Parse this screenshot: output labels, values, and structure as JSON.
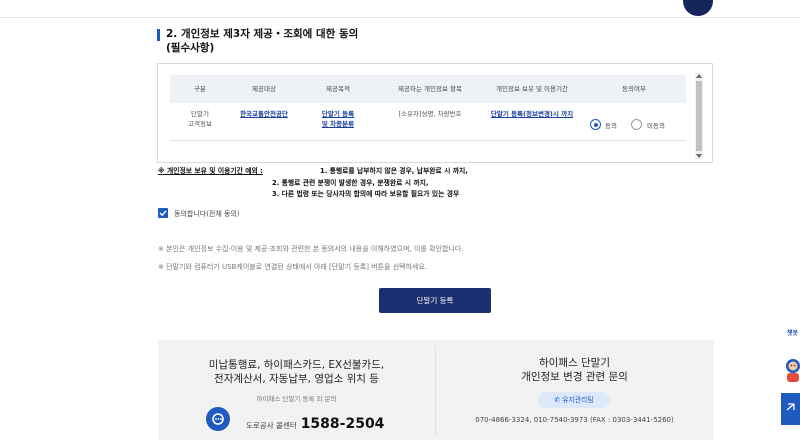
{
  "section": {
    "title": "2. 개인정보 제3자 제공・조회에 대한 동의",
    "subtitle": "(필수사항)"
  },
  "table": {
    "headers": [
      "구분",
      "제공대상",
      "제공목적",
      "제공하는 개인정보 항목",
      "개인정보 보유 및 이용기간",
      "동의여부"
    ],
    "row": {
      "type_line1": "단말기",
      "type_line2": "고객정보",
      "provider": "한국교통안전공단",
      "purpose_line1": "단말기 등록",
      "purpose_line2": "및 차종분류",
      "items": "[소유자]성명, 차량번호",
      "period": "단말기 등록(정보변경)시 까지",
      "agree_label": "동의",
      "disagree_label": "미동의",
      "agree_selected": true
    }
  },
  "retention_note": {
    "prefix": "※ 개인정보 보유 및 이용기간 예외 :",
    "line1": "1. 통행료를 납부하지 않은 경우, 납부완료 시 까지,",
    "line2": "2. 통행료 관련 분쟁이 발생한 경우, 분쟁완료 시 까지,",
    "line3": "3. 다른 법령 또는 당사자의 합의에 따라 보유할 필요가 있는 경우"
  },
  "consent_all": {
    "label": "동의합니다(전체 동의)",
    "checked": true
  },
  "notices": [
    "※ 본인은 개인정보 수집·이용 및 제공·조회와 관련한 본 동의서의 내용을 이해하였으며, 이를 확인합니다.",
    "※ 단말기와 컴퓨터가 USB케이블로 연결된 상태에서 아래 [단말기 등록] 버튼을 선택하세요."
  ],
  "register_button": "단말기 등록",
  "info_left": {
    "line1": "미납통행료, 하이패스카드, EX선불카드,",
    "line2": "전자계산서, 자동납부, 영업소 위치 등",
    "sub": "하이패스 단말기 등록 외 문의",
    "tel_label": "도로공사 콜센터",
    "tel_number": "1588-2504"
  },
  "info_right": {
    "line1": "하이패스 단말기",
    "line2": "개인정보 변경 관련 문의",
    "pill": "유지관리팀",
    "phones": "070-4866-3324, 010-7540-3973 (FAX : 0303-3441-5260)"
  },
  "side": {
    "chatbot_label": "챗봇"
  },
  "colors": {
    "primary": "#1f5bbf",
    "navy": "#1c2f70",
    "link": "#1b3fa0"
  }
}
